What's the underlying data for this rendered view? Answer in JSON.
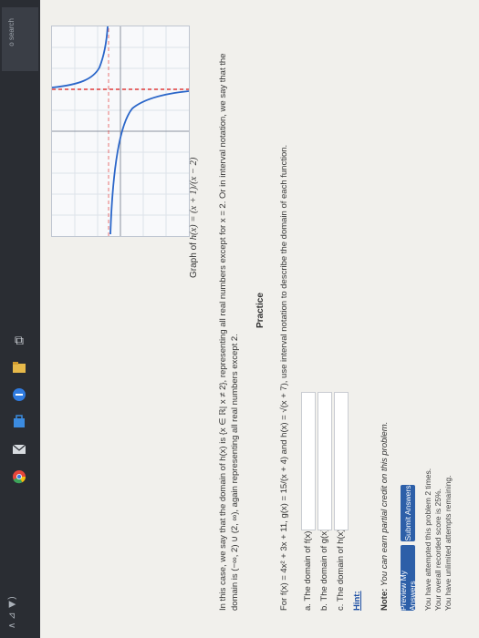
{
  "taskbar": {
    "search_text": "o search",
    "tray_text": "∧ ⊿ ◀)",
    "icons": [
      "task-view-icon",
      "file-explorer-icon",
      "edge-icon",
      "store-icon",
      "mail-icon",
      "chrome-icon"
    ]
  },
  "page": {
    "graph_title_prefix": "Graph of",
    "graph_title_math": "h(x) = (x + 1)/(x − 2)",
    "domain_line1": "In this case, we say that the domain of h(x) is {x ∈ ℝ| x ≠ 2}, representing all real numbers except for x = 2. Or in interval notation, we say that the",
    "domain_line2": "domain is (−∞, 2) ∪ (2, ∞), again representing all real numbers except 2.",
    "practice_title": "Practice",
    "practice_prompt": "For f(x) = 4x² + 3x + 11, g(x) = 15/(x + 4) and h(x) = √(x + 7), use interval notation to describe the domain of each function.",
    "questions": [
      {
        "label": "a. The domain of f(x) is",
        "value": ""
      },
      {
        "label": "b. The domain of g(x) is",
        "value": ""
      },
      {
        "label": "c. The domain of h(x) is",
        "value": ""
      }
    ],
    "hint": "Hint:",
    "note_prefix": "Note:",
    "note_text": "You can earn partial credit on this problem.",
    "preview_button": "Preview My Answers",
    "submit_button": "Submit Answers",
    "attempts": [
      "You have attempted this problem 2 times.",
      "Your overall recorded score is 25%.",
      "You have unlimited attempts remaining."
    ]
  },
  "colors": {
    "button": "#2d5fa8",
    "curve": "#2a66c9",
    "asymptote": "#e03a3a"
  }
}
